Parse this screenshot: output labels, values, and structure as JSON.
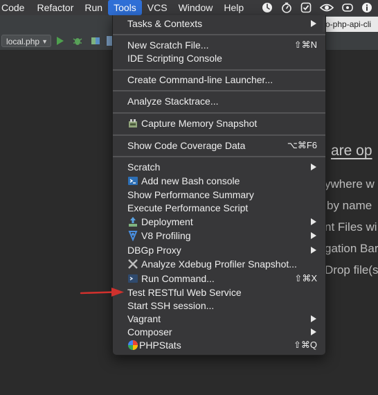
{
  "menubar": {
    "items": [
      "Code",
      "Refactor",
      "Run",
      "Tools",
      "VCS",
      "Window",
      "Help"
    ],
    "active": "Tools",
    "tray_icons": [
      "clock-icon",
      "stopwatch-icon",
      "checkbox-icon",
      "eye-icon",
      "scale-icon",
      "info-icon"
    ]
  },
  "editor": {
    "tab_title": "o-php-api-cli",
    "run_config": "local.php",
    "welcome_lines": [
      "are op",
      "ywhere w",
      "by name",
      "nt Files wi",
      "gation Bar",
      "Drop file(s)"
    ]
  },
  "tools_menu": {
    "items": [
      {
        "label": "Tasks & Contexts",
        "submenu": true
      },
      {
        "separator": true
      },
      {
        "label": "New Scratch File...",
        "shortcut": "⇧⌘N"
      },
      {
        "label": "IDE Scripting Console"
      },
      {
        "separator": true
      },
      {
        "label": "Create Command-line Launcher..."
      },
      {
        "separator": true
      },
      {
        "label": "Analyze Stacktrace..."
      },
      {
        "separator": true
      },
      {
        "label": "Capture Memory Snapshot",
        "icon": "memory-snapshot-icon"
      },
      {
        "separator": true
      },
      {
        "label": "Show Code Coverage Data",
        "shortcut": "⌥⌘F6"
      },
      {
        "separator": true
      },
      {
        "label": "Scratch",
        "submenu": true
      },
      {
        "label": "Add new Bash console",
        "icon": "terminal-icon"
      },
      {
        "label": "Show Performance Summary"
      },
      {
        "label": "Execute Performance Script"
      },
      {
        "label": "Deployment",
        "icon": "deployment-icon",
        "submenu": true
      },
      {
        "label": "V8 Profiling",
        "icon": "v8-profiling-icon",
        "submenu": true
      },
      {
        "label": "DBGp Proxy",
        "submenu": true
      },
      {
        "label": "Analyze Xdebug Profiler Snapshot...",
        "icon": "xdebug-icon"
      },
      {
        "label": "Run Command...",
        "icon": "run-command-icon",
        "shortcut": "⇧⌘X"
      },
      {
        "label": "Test RESTful Web Service"
      },
      {
        "label": "Start SSH session..."
      },
      {
        "label": "Vagrant",
        "submenu": true
      },
      {
        "label": "Composer",
        "submenu": true
      },
      {
        "label": "PHPStats",
        "icon": "phpstats-icon",
        "shortcut": "⇧⌘Q"
      }
    ]
  },
  "colors": {
    "menu_background": "#38383a",
    "menubar_highlight": "#2f6fd6",
    "annotation_arrow": "#d0312d"
  }
}
